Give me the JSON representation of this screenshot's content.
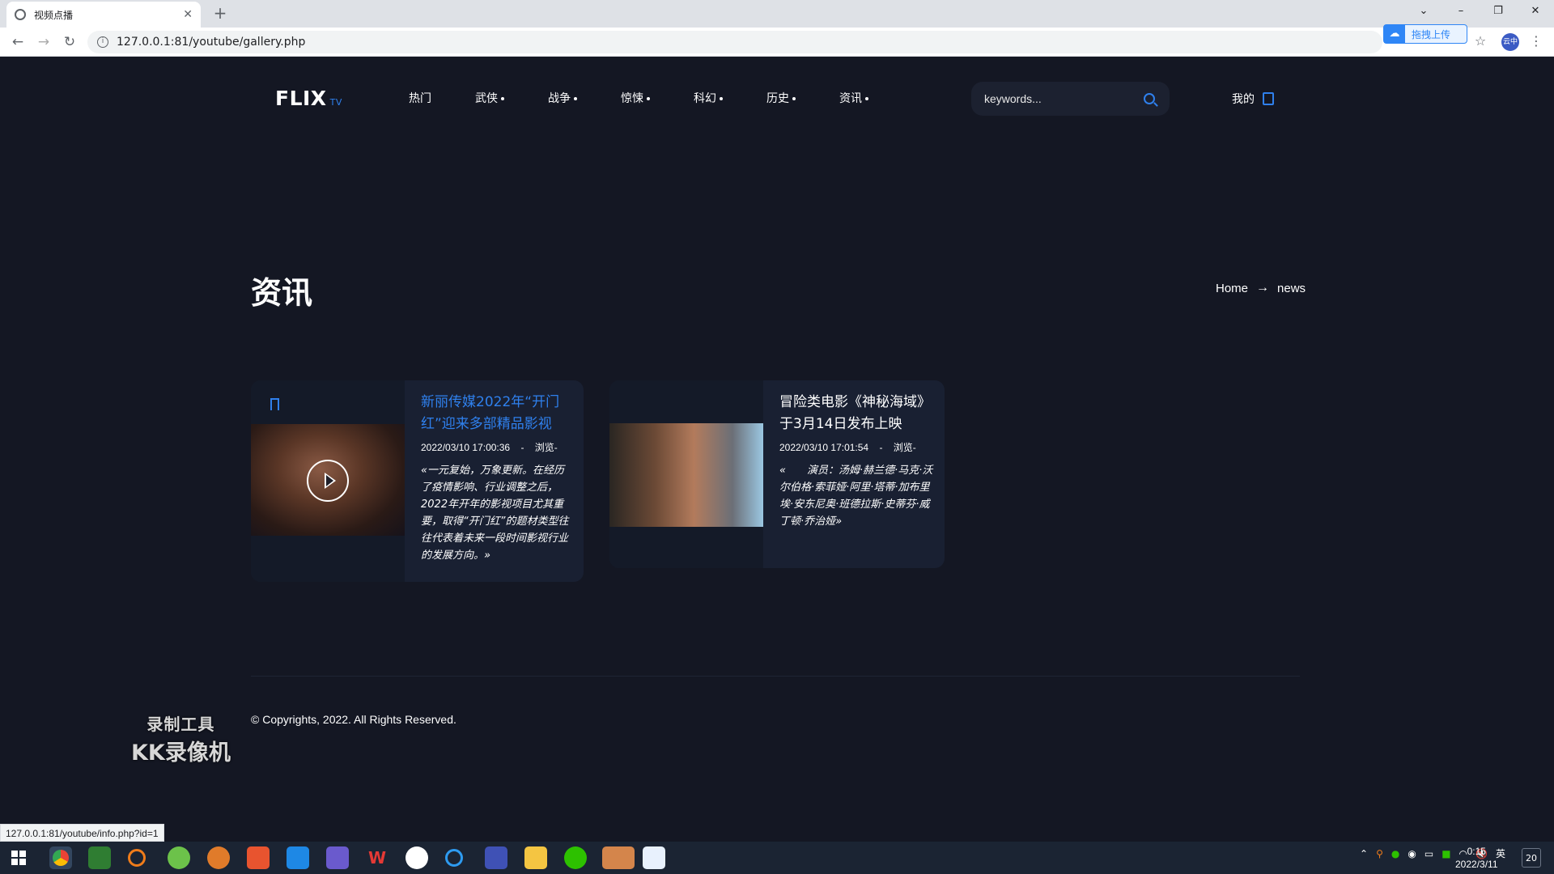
{
  "browser": {
    "tab_title": "视频点播",
    "url": "127.0.0.1:81/youtube/gallery.php",
    "extension_label": "拖拽上传",
    "profile_label": "云中",
    "status_url": "127.0.0.1:81/youtube/info.php?id=1"
  },
  "site": {
    "logo": "FLIX",
    "logo_suffix": "TV",
    "menu": [
      {
        "label": "热门"
      },
      {
        "label": "武侠"
      },
      {
        "label": "战争"
      },
      {
        "label": "惊悚"
      },
      {
        "label": "科幻"
      },
      {
        "label": "历史"
      },
      {
        "label": "资讯"
      }
    ],
    "search_placeholder": "keywords...",
    "account_label": "我的"
  },
  "page": {
    "title": "资讯",
    "breadcrumb": {
      "home": "Home",
      "arrow": "→",
      "current": "news"
    }
  },
  "news": [
    {
      "title": "新丽传媒2022年“开门红”迎来多部精品影视",
      "date": "2022/03/10 17:00:36",
      "sep": "-",
      "views_label": "浏览-",
      "excerpt": "«一元复始，万象更新。在经历了疫情影响、行业调整之后，2022年开年的影视项目尤其重要，取得“开门红”的题材类型往往代表着未来一段时间影视行业的发展方向。»"
    },
    {
      "title": "冒险类电影《神秘海域》于3月14日发布上映",
      "date": "2022/03/10 17:01:54",
      "sep": "-",
      "views_label": "浏览-",
      "excerpt": "«　　演员：汤姆·赫兰德·马克·沃尔伯格·索菲娅·阿里·塔蒂·加布里埃·安东尼奥·班德拉斯·史蒂芬·威丁顿·乔治娅»"
    }
  ],
  "footer": {
    "copyright": "© Copyrights, 2022. All Rights Reserved."
  },
  "watermark": {
    "line1": "录制工具",
    "line2": "KK录像机"
  },
  "taskbar": {
    "time": "0:15",
    "date": "2022/3/11",
    "ime": "英",
    "notifications": "20"
  },
  "colors": {
    "accent": "#2f80ed",
    "background": "#141723",
    "card": "#192032"
  }
}
